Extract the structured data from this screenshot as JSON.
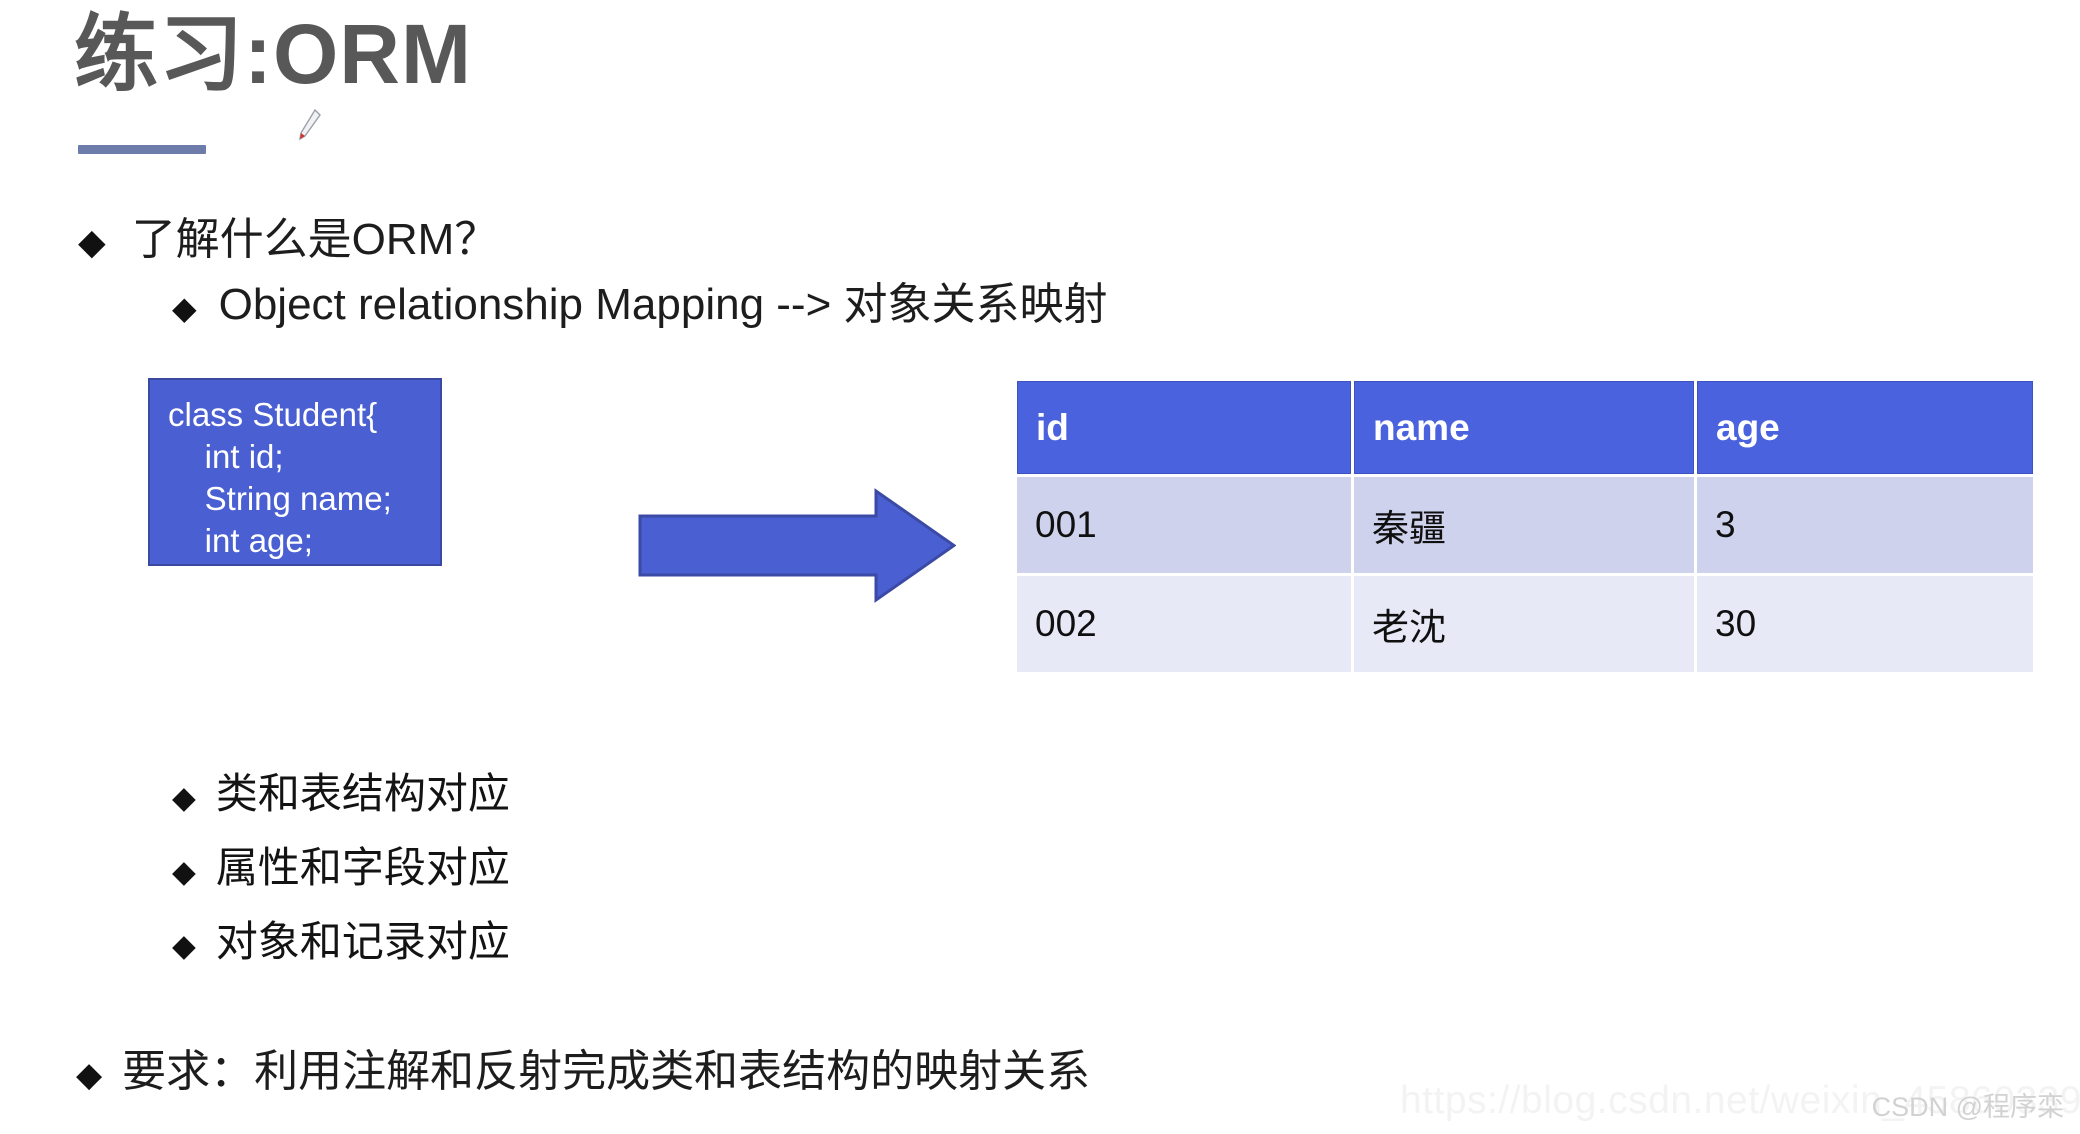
{
  "slide": {
    "title": "练习:ORM",
    "title_color": "#585858",
    "rule_color": "#6d7cab",
    "accent_blue": "#4a62dd",
    "code_bg": "#4a5fd2",
    "row_a_bg": "#ced2ec",
    "row_b_bg": "#e7e9f6"
  },
  "bullets": {
    "level1": {
      "marker": "◆",
      "text": "了解什么是ORM？"
    },
    "level2": {
      "marker": "◆",
      "text": "Object relationship Mapping --> 对象关系映射"
    }
  },
  "code_block": {
    "lines": [
      "class Student{",
      "    int id;",
      "    String name;",
      "    int age;",
      "}"
    ]
  },
  "arrow": {
    "name": "right-arrow",
    "fill": "#4a5fd2",
    "stroke": "#3b4aa4"
  },
  "table": {
    "headers": [
      "id",
      "name",
      "age"
    ],
    "rows": [
      [
        "001",
        "秦疆",
        "3"
      ],
      [
        "002",
        "老沈",
        "30"
      ]
    ]
  },
  "mapping_points": [
    {
      "marker": "◆",
      "text": "类和表结构对应"
    },
    {
      "marker": "◆",
      "text": "属性和字段对应"
    },
    {
      "marker": "◆",
      "text": "对象和记录对应"
    }
  ],
  "requirement": {
    "marker": "◆",
    "text": "要求：利用注解和反射完成类和表结构的映射关系"
  },
  "watermark": {
    "url": "https://blog.csdn.net/weixin_45860339",
    "credit": "CSDN @程序栾"
  }
}
